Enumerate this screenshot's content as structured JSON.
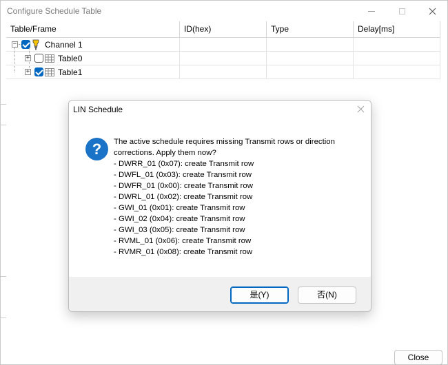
{
  "window": {
    "title": "Configure Schedule Table",
    "close_label": "Close"
  },
  "grid": {
    "columns": [
      "Table/Frame",
      "ID(hex)",
      "Type",
      "Delay[ms]"
    ],
    "rows": [
      {
        "label": "Channel 1",
        "checked": true,
        "icon": "lamp-icon"
      },
      {
        "label": "Table0",
        "checked": false,
        "icon": "table-icon"
      },
      {
        "label": "Table1",
        "checked": true,
        "icon": "table-icon"
      }
    ]
  },
  "dialog": {
    "title": "LIN Schedule",
    "message_lines": [
      "The active schedule requires missing Transmit rows or direction",
      "corrections. Apply them now?",
      "- DWRR_01 (0x07): create Transmit row",
      "- DWFL_01 (0x03): create Transmit row",
      "- DWFR_01 (0x00): create Transmit row",
      "- DWRL_01 (0x02): create Transmit row",
      "- GWI_01 (0x01): create Transmit row",
      "- GWI_02 (0x04): create Transmit row",
      "- GWI_03 (0x05): create Transmit row",
      "- RVML_01 (0x06): create Transmit row",
      "- RVMR_01 (0x08): create Transmit row"
    ],
    "yes_label": "是(Y)",
    "no_label": "否(N)",
    "icon": "question-icon"
  },
  "colors": {
    "accent": "#0067c0",
    "question_icon": "#1a73c7"
  }
}
